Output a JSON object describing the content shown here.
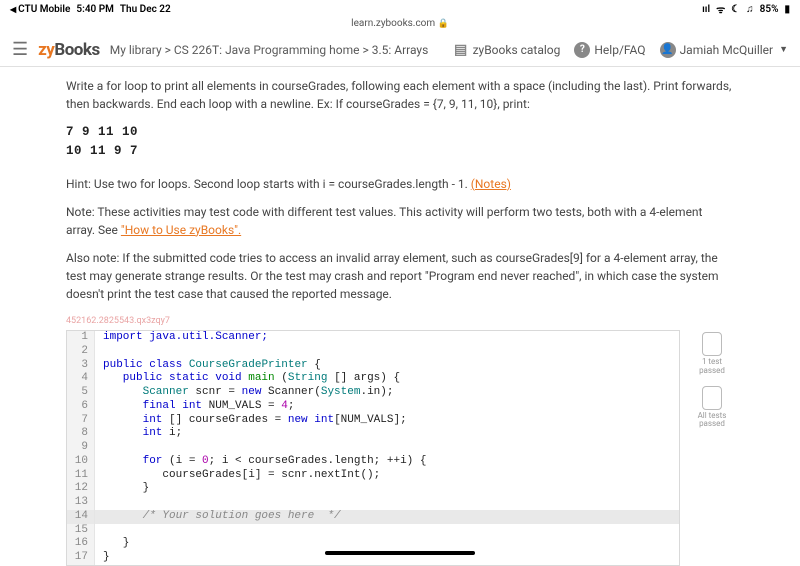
{
  "ios": {
    "back_app": "CTU Mobile",
    "time": "5:40 PM",
    "date": "Thu Dec 22",
    "signal": "ııl",
    "wifi": "ᯤ",
    "moon": "☾",
    "headphones": "♫",
    "battery_pct": "85%"
  },
  "browser": {
    "url": "learn.zybooks.com",
    "lock": "🔒"
  },
  "header": {
    "brand_zy": "zy",
    "brand_books": "Books",
    "crumb1": "My library",
    "crumb2": "CS 226T: Java Programming home",
    "crumb3": "3.5: Arrays",
    "sep": " > ",
    "catalog": "zyBooks catalog",
    "help": "Help/FAQ",
    "user": "Jamiah McQuiller"
  },
  "body": {
    "p1": "Write a for loop to print all elements in courseGrades, following each element with a space (including the last). Print forwards, then backwards. End each loop with a newline. Ex: If courseGrades = {7, 9, 11, 10}, print:",
    "code_out": "7 9 11 10\n10 11 9 7",
    "hint_pre": "Hint: Use two for loops. Second loop starts with i = courseGrades.length - 1. ",
    "hint_link": "(Notes)",
    "note1_pre": "Note: These activities may test code with different test values. This activity will perform two tests, both with a 4-element array. See ",
    "note1_link": "\"How to Use zyBooks\".",
    "note2": "Also note: If the submitted code tries to access an invalid array element, such as courseGrades[9] for a 4-element array, the test may generate strange results. Or the test may crash and report \"Program end never reached\", in which case the system doesn't print the test case that caused the reported message.",
    "watermark": "452162.2825543.qx3zqy7"
  },
  "tests": {
    "t1": "1 test\npassed",
    "t2": "All tests\npassed"
  },
  "code": {
    "l1": "import java.util.Scanner;",
    "l3a": "public class ",
    "l3b": "CourseGradePrinter",
    "l3c": " {",
    "l4a": "   public static void ",
    "l4b": "main ",
    "l4c": "(",
    "l4d": "String",
    "l4e": " [] args) {",
    "l5a": "      ",
    "l5b": "Scanner",
    "l5c": " scnr = ",
    "l5d": "new ",
    "l5e": "Scanner(",
    "l5f": "System",
    "l5g": ".in);",
    "l6a": "      ",
    "l6b": "final int ",
    "l6c": "NUM_VALS = ",
    "l6d": "4",
    "l6e": ";",
    "l7a": "      ",
    "l7b": "int",
    "l7c": " [] courseGrades = ",
    "l7d": "new int",
    "l7e": "[NUM_VALS];",
    "l8a": "      ",
    "l8b": "int",
    "l8c": " i;",
    "l10a": "      ",
    "l10b": "for",
    "l10c": " (i = ",
    "l10d": "0",
    "l10e": "; i < courseGrades.length; ++i) {",
    "l11": "         courseGrades[i] = scnr.nextInt();",
    "l12": "      }",
    "l14a": "      ",
    "l14b": "/* Your solution goes here  */",
    "l16": "   }",
    "l17": "}"
  }
}
